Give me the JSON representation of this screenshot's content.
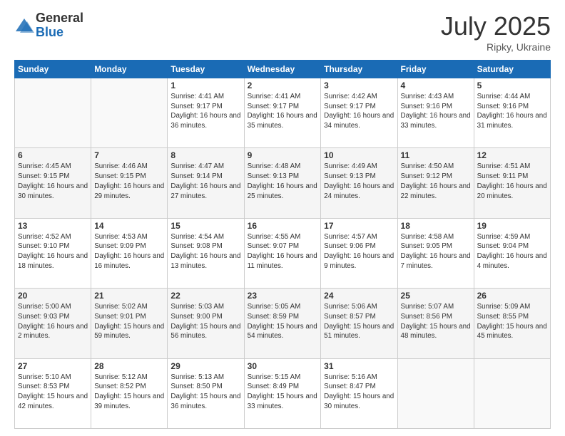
{
  "header": {
    "logo_general": "General",
    "logo_blue": "Blue",
    "title": "July 2025",
    "location": "Ripky, Ukraine"
  },
  "days_of_week": [
    "Sunday",
    "Monday",
    "Tuesday",
    "Wednesday",
    "Thursday",
    "Friday",
    "Saturday"
  ],
  "weeks": [
    [
      {
        "day": "",
        "info": ""
      },
      {
        "day": "",
        "info": ""
      },
      {
        "day": "1",
        "info": "Sunrise: 4:41 AM\nSunset: 9:17 PM\nDaylight: 16 hours and 36 minutes."
      },
      {
        "day": "2",
        "info": "Sunrise: 4:41 AM\nSunset: 9:17 PM\nDaylight: 16 hours and 35 minutes."
      },
      {
        "day": "3",
        "info": "Sunrise: 4:42 AM\nSunset: 9:17 PM\nDaylight: 16 hours and 34 minutes."
      },
      {
        "day": "4",
        "info": "Sunrise: 4:43 AM\nSunset: 9:16 PM\nDaylight: 16 hours and 33 minutes."
      },
      {
        "day": "5",
        "info": "Sunrise: 4:44 AM\nSunset: 9:16 PM\nDaylight: 16 hours and 31 minutes."
      }
    ],
    [
      {
        "day": "6",
        "info": "Sunrise: 4:45 AM\nSunset: 9:15 PM\nDaylight: 16 hours and 30 minutes."
      },
      {
        "day": "7",
        "info": "Sunrise: 4:46 AM\nSunset: 9:15 PM\nDaylight: 16 hours and 29 minutes."
      },
      {
        "day": "8",
        "info": "Sunrise: 4:47 AM\nSunset: 9:14 PM\nDaylight: 16 hours and 27 minutes."
      },
      {
        "day": "9",
        "info": "Sunrise: 4:48 AM\nSunset: 9:13 PM\nDaylight: 16 hours and 25 minutes."
      },
      {
        "day": "10",
        "info": "Sunrise: 4:49 AM\nSunset: 9:13 PM\nDaylight: 16 hours and 24 minutes."
      },
      {
        "day": "11",
        "info": "Sunrise: 4:50 AM\nSunset: 9:12 PM\nDaylight: 16 hours and 22 minutes."
      },
      {
        "day": "12",
        "info": "Sunrise: 4:51 AM\nSunset: 9:11 PM\nDaylight: 16 hours and 20 minutes."
      }
    ],
    [
      {
        "day": "13",
        "info": "Sunrise: 4:52 AM\nSunset: 9:10 PM\nDaylight: 16 hours and 18 minutes."
      },
      {
        "day": "14",
        "info": "Sunrise: 4:53 AM\nSunset: 9:09 PM\nDaylight: 16 hours and 16 minutes."
      },
      {
        "day": "15",
        "info": "Sunrise: 4:54 AM\nSunset: 9:08 PM\nDaylight: 16 hours and 13 minutes."
      },
      {
        "day": "16",
        "info": "Sunrise: 4:55 AM\nSunset: 9:07 PM\nDaylight: 16 hours and 11 minutes."
      },
      {
        "day": "17",
        "info": "Sunrise: 4:57 AM\nSunset: 9:06 PM\nDaylight: 16 hours and 9 minutes."
      },
      {
        "day": "18",
        "info": "Sunrise: 4:58 AM\nSunset: 9:05 PM\nDaylight: 16 hours and 7 minutes."
      },
      {
        "day": "19",
        "info": "Sunrise: 4:59 AM\nSunset: 9:04 PM\nDaylight: 16 hours and 4 minutes."
      }
    ],
    [
      {
        "day": "20",
        "info": "Sunrise: 5:00 AM\nSunset: 9:03 PM\nDaylight: 16 hours and 2 minutes."
      },
      {
        "day": "21",
        "info": "Sunrise: 5:02 AM\nSunset: 9:01 PM\nDaylight: 15 hours and 59 minutes."
      },
      {
        "day": "22",
        "info": "Sunrise: 5:03 AM\nSunset: 9:00 PM\nDaylight: 15 hours and 56 minutes."
      },
      {
        "day": "23",
        "info": "Sunrise: 5:05 AM\nSunset: 8:59 PM\nDaylight: 15 hours and 54 minutes."
      },
      {
        "day": "24",
        "info": "Sunrise: 5:06 AM\nSunset: 8:57 PM\nDaylight: 15 hours and 51 minutes."
      },
      {
        "day": "25",
        "info": "Sunrise: 5:07 AM\nSunset: 8:56 PM\nDaylight: 15 hours and 48 minutes."
      },
      {
        "day": "26",
        "info": "Sunrise: 5:09 AM\nSunset: 8:55 PM\nDaylight: 15 hours and 45 minutes."
      }
    ],
    [
      {
        "day": "27",
        "info": "Sunrise: 5:10 AM\nSunset: 8:53 PM\nDaylight: 15 hours and 42 minutes."
      },
      {
        "day": "28",
        "info": "Sunrise: 5:12 AM\nSunset: 8:52 PM\nDaylight: 15 hours and 39 minutes."
      },
      {
        "day": "29",
        "info": "Sunrise: 5:13 AM\nSunset: 8:50 PM\nDaylight: 15 hours and 36 minutes."
      },
      {
        "day": "30",
        "info": "Sunrise: 5:15 AM\nSunset: 8:49 PM\nDaylight: 15 hours and 33 minutes."
      },
      {
        "day": "31",
        "info": "Sunrise: 5:16 AM\nSunset: 8:47 PM\nDaylight: 15 hours and 30 minutes."
      },
      {
        "day": "",
        "info": ""
      },
      {
        "day": "",
        "info": ""
      }
    ]
  ]
}
